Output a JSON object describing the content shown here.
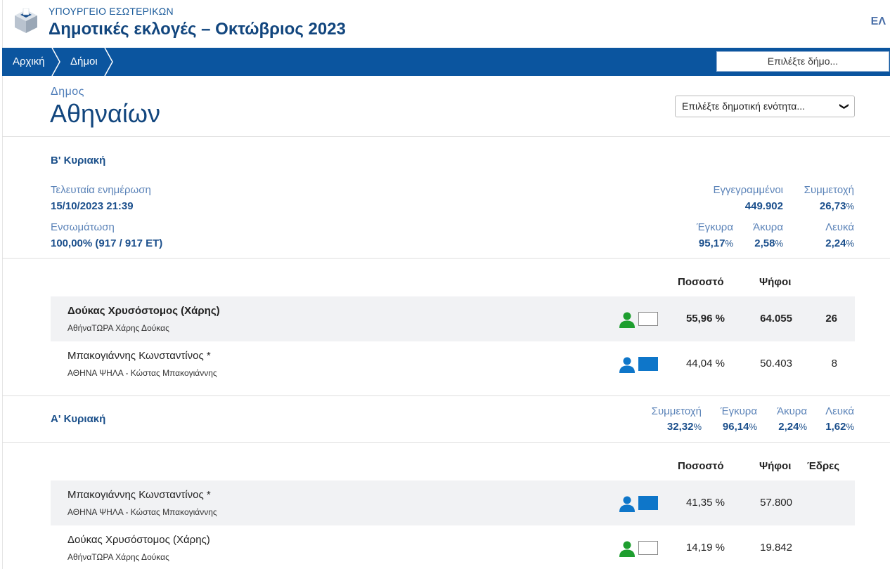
{
  "header": {
    "ministry": "ΥΠΟΥΡΓΕΙΟ ΕΣΩΤΕΡΙΚΩΝ",
    "title": "Δημοτικές εκλογές – Οκτώβριος 2023",
    "language": "ΕΛ"
  },
  "nav": {
    "breadcrumbs": [
      "Αρχική",
      "Δήμοι"
    ],
    "municipality_select_placeholder": "Επιλέξτε δήμο..."
  },
  "municipality": {
    "label": "Δημος",
    "name": "Αθηναίων",
    "unit_select_placeholder": "Επιλέξτε δημοτική ενότητα..."
  },
  "round2": {
    "title": "Β' Κυριακή",
    "last_update_label": "Τελευταία ενημέρωση",
    "last_update_value": "15/10/2023 21:39",
    "incorporation_label": "Ενσωμάτωση",
    "incorporation_value": "100,00% (917 / 917 ΕΤ)",
    "registered_label": "Εγγεγραμμένοι",
    "registered_value": "449.902",
    "turnout_label": "Συμμετοχή",
    "turnout_value": "26,73",
    "valid_label": "Έγκυρα",
    "valid_value": "95,17",
    "invalid_label": "Άκυρα",
    "invalid_value": "2,58",
    "blank_label": "Λευκά",
    "blank_value": "2,24",
    "pct_sign": "%",
    "col_percent": "Ποσοστό",
    "col_votes": "Ψήφοι",
    "candidates": [
      {
        "name": "Δούκας Χρυσόστομος (Χάρης)",
        "party": "ΑθήναΤΩΡΑ Χάρης Δούκας",
        "percent": "55,96 %",
        "votes": "64.055",
        "seats": "26",
        "icon_color": "#1e9e2f",
        "box": "empty"
      },
      {
        "name": "Μπακογιάννης Κωνσταντίνος *",
        "party": "ΑΘΗΝΑ ΨΗΛΑ - Κώστας Μπακογιάννης",
        "percent": "44,04 %",
        "votes": "50.403",
        "seats": "8",
        "icon_color": "#0e76c9",
        "box": "filled"
      }
    ]
  },
  "round1": {
    "title": "Α' Κυριακή",
    "turnout_label": "Συμμετοχή",
    "turnout_value": "32,32",
    "valid_label": "Έγκυρα",
    "valid_value": "96,14",
    "invalid_label": "Άκυρα",
    "invalid_value": "2,24",
    "blank_label": "Λευκά",
    "blank_value": "1,62",
    "pct_sign": "%",
    "col_percent": "Ποσοστό",
    "col_votes": "Ψήφοι",
    "col_seats": "Έδρες",
    "candidates": [
      {
        "name": "Μπακογιάννης Κωνσταντίνος *",
        "party": "ΑΘΗΝΑ ΨΗΛΑ - Κώστας Μπακογιάννης",
        "percent": "41,35 %",
        "votes": "57.800",
        "icon_color": "#0e76c9",
        "box": "filled"
      },
      {
        "name": "Δούκας Χρυσόστομος (Χάρης)",
        "party": "ΑθήναΤΩΡΑ Χάρης Δούκας",
        "percent": "14,19 %",
        "votes": "19.842",
        "icon_color": "#1e9e2f",
        "box": "empty"
      }
    ]
  }
}
